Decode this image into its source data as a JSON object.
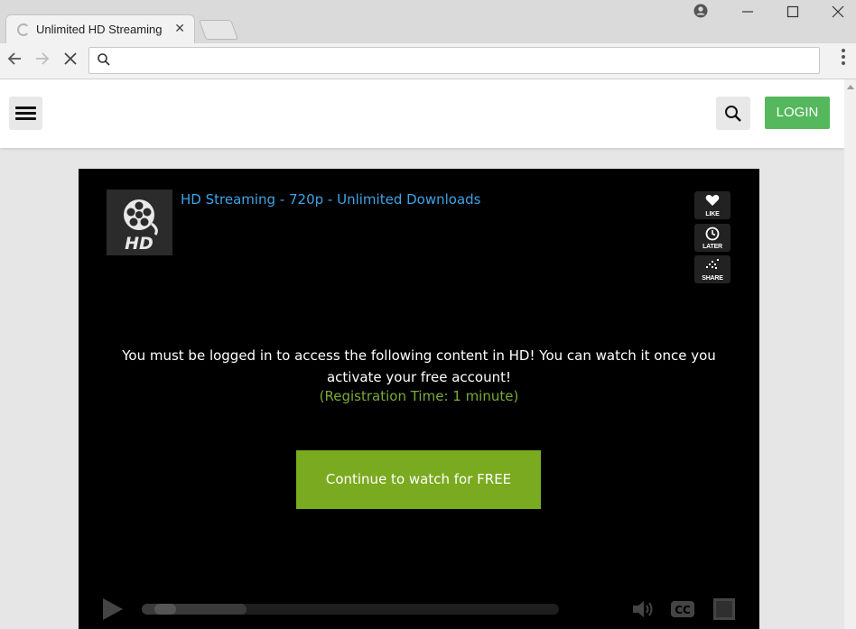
{
  "browser": {
    "tab_title": "Unlimited HD Streaming",
    "tab_close": "✕",
    "address_value": "",
    "controls": {
      "profile_icon": "profile-icon",
      "minimize": "—",
      "maximize": "☐",
      "close": "✕"
    },
    "nav": {
      "back": "←",
      "forward": "→",
      "stop": "✕"
    }
  },
  "site": {
    "login_label": "LOGIN",
    "login_color": "#55b85c"
  },
  "player": {
    "title": "HD Streaming - 720p - Unlimited Downloads",
    "title_color": "#3fa3e6",
    "logo_text": "HD",
    "side_buttons": [
      {
        "label": "LIKE",
        "icon": "heart-icon"
      },
      {
        "label": "LATER",
        "icon": "clock-icon"
      },
      {
        "label": "SHARE",
        "icon": "share-icon"
      }
    ],
    "message": "You must be logged in to access the following content in HD! You can watch it once you activate your free account!",
    "registration_time": "(Registration Time: 1 minute)",
    "registration_color": "#79aa3a",
    "cta_label": "Continue to watch for FREE",
    "cta_color": "#7aaa1f",
    "progress_buffered": 0.25,
    "cc_label": "CC"
  }
}
